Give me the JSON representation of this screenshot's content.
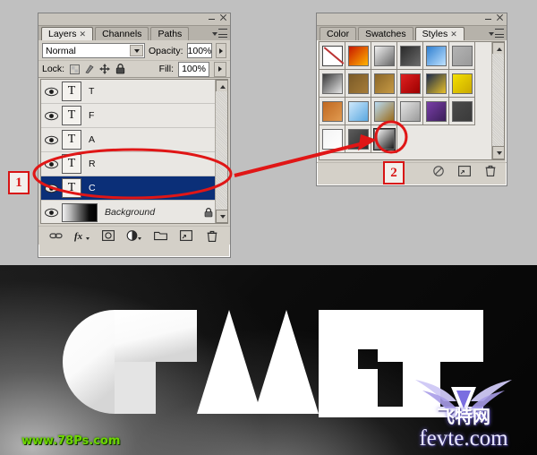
{
  "layers_panel": {
    "window_title": "",
    "tabs": [
      {
        "label": "Layers",
        "active": true,
        "closable": true
      },
      {
        "label": "Channels",
        "active": false,
        "closable": false
      },
      {
        "label": "Paths",
        "active": false,
        "closable": false
      }
    ],
    "blend_mode": "Normal",
    "opacity_label": "Opacity:",
    "opacity_value": "100%",
    "lock_label": "Lock:",
    "fill_label": "Fill:",
    "fill_value": "100%",
    "lock_icons": [
      "lock-transparent-pixels",
      "lock-image-pixels",
      "lock-position",
      "lock-all"
    ],
    "layers": [
      {
        "name": "T",
        "type": "text",
        "visible": true,
        "selected": false,
        "locked": false
      },
      {
        "name": "F",
        "type": "text",
        "visible": true,
        "selected": false,
        "locked": false
      },
      {
        "name": "A",
        "type": "text",
        "visible": true,
        "selected": false,
        "locked": false
      },
      {
        "name": "R",
        "type": "text",
        "visible": true,
        "selected": false,
        "locked": false
      },
      {
        "name": "C",
        "type": "text",
        "visible": true,
        "selected": true,
        "locked": false
      },
      {
        "name": "Background",
        "type": "image",
        "visible": true,
        "selected": false,
        "locked": true
      }
    ],
    "footer_buttons": [
      "link-layers-icon",
      "add-layer-style-icon",
      "add-layer-mask-icon",
      "new-adjustment-layer-icon",
      "new-group-icon",
      "new-layer-icon",
      "delete-layer-icon"
    ]
  },
  "styles_panel": {
    "tabs": [
      {
        "label": "Color",
        "active": false,
        "closable": false
      },
      {
        "label": "Swatches",
        "active": false,
        "closable": false
      },
      {
        "label": "Styles",
        "active": true,
        "closable": true
      }
    ],
    "swatches": [
      {
        "id": "none",
        "kind": "none",
        "color": "#ffffff"
      },
      {
        "id": "red-glow",
        "kind": "swatch",
        "color": "#c81800",
        "color2": "#ffb400"
      },
      {
        "id": "gray-bevel",
        "kind": "swatch",
        "color": "#f0f0f0",
        "color2": "#666666"
      },
      {
        "id": "dark-textured",
        "kind": "swatch",
        "color": "#2a2a2a",
        "color2": "#6a6a6a"
      },
      {
        "id": "blue-glass",
        "kind": "swatch",
        "color": "#2f7fd0",
        "color2": "#bfe2ff"
      },
      {
        "id": "flat-gray",
        "kind": "swatch",
        "color": "#b3b3b3",
        "color2": "#9a9a9a"
      },
      {
        "id": "gray-fade",
        "kind": "swatch",
        "color": "#3a3a3a",
        "color2": "#e6e6e6"
      },
      {
        "id": "bronze",
        "kind": "swatch",
        "color": "#7a5a28",
        "color2": "#a67c38"
      },
      {
        "id": "gold-brown",
        "kind": "swatch",
        "color": "#8a6628",
        "color2": "#c79a44"
      },
      {
        "id": "red-stripes",
        "kind": "swatch",
        "color": "#e02020",
        "color2": "#9c0000"
      },
      {
        "id": "rainbow-splash",
        "kind": "swatch",
        "color": "#1b2a4a",
        "color2": "#e8c02a"
      },
      {
        "id": "yellow-glass",
        "kind": "swatch",
        "color": "#f4e000",
        "color2": "#caa800"
      },
      {
        "id": "orange-texture",
        "kind": "swatch",
        "color": "#c06820",
        "color2": "#e09a50"
      },
      {
        "id": "sky-blue",
        "kind": "swatch",
        "color": "#cfe8fb",
        "color2": "#5aa8e0"
      },
      {
        "id": "beach-gradient",
        "kind": "swatch",
        "color": "#b9dcf4",
        "color2": "#9a6a18"
      },
      {
        "id": "white-noise",
        "kind": "swatch",
        "color": "#e4e4e4",
        "color2": "#9a9a9a"
      },
      {
        "id": "purple-block",
        "kind": "swatch",
        "color": "#7a3fa8",
        "color2": "#3a1e58"
      },
      {
        "id": "dark-gray-flat",
        "kind": "swatch",
        "color": "#4a4a4a",
        "color2": "#3a3a3a"
      },
      {
        "id": "white-outline",
        "kind": "swatch",
        "color": "#f4f4f4",
        "color2": "#ffffff"
      },
      {
        "id": "charcoal",
        "kind": "swatch",
        "color": "#5a5a5a",
        "color2": "#2e2e2e"
      },
      {
        "id": "white-black-corner",
        "kind": "swatch",
        "color": "#ffffff",
        "color2": "#1a1a1a"
      }
    ],
    "selected_swatch_index": 20,
    "footer_buttons": [
      "clear-style-icon",
      "new-style-icon",
      "delete-style-icon"
    ]
  },
  "annotations": {
    "marker_1": "1",
    "marker_2": "2",
    "accent_color": "#d81414"
  },
  "photo": {
    "logo_text": "CRAFT",
    "watermark_left": "www.78Ps.com",
    "watermark_right_domain": "fevte.com",
    "watermark_right_cn": "飞特网"
  }
}
